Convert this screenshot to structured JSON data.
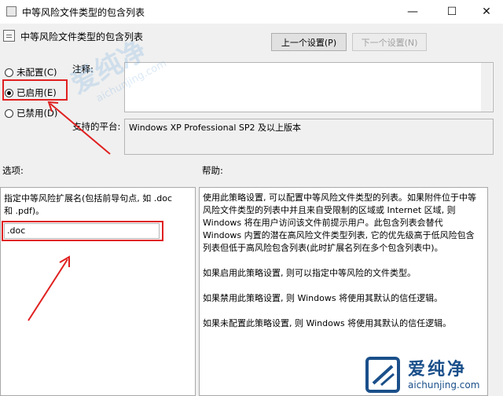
{
  "window": {
    "title": "中等风险文件类型的包含列表",
    "controls": {
      "minimize": "—",
      "maximize": "☐",
      "close": "✕"
    }
  },
  "header": {
    "title": "中等风险文件类型的包含列表",
    "prev_button": "上一个设置(P)",
    "next_button": "下一个设置(N)"
  },
  "state": {
    "options": [
      {
        "label": "未配置(C)",
        "checked": false
      },
      {
        "label": "已启用(E)",
        "checked": true
      },
      {
        "label": "已禁用(D)",
        "checked": false
      }
    ],
    "comment_label": "注释:",
    "comment_value": "",
    "supported_label": "支持的平台:",
    "supported_value": "Windows XP Professional SP2 及以上版本"
  },
  "options_pane": {
    "heading": "选项:",
    "description": "指定中等风险扩展名(包括前导句点, 如 .doc\n和 .pdf)。",
    "input_value": ".doc"
  },
  "help_pane": {
    "heading": "帮助:",
    "text": "使用此策略设置, 可以配置中等风险文件类型的列表。如果附件位于中等\n风险文件类型的列表中并且来自受限制的区域或 Internet 区域, 则\nWindows 将在用户访问该文件前提示用户。此包含列表会替代\nWindows 内置的潜在高风险文件类型列表, 它的优先级高于低风险包含\n列表但低于高风险包含列表(此时扩展名列在多个包含列表中)。\n\n如果启用此策略设置, 则可以指定中等风险的文件类型。\n\n如果禁用此策略设置, 则 Windows 将使用其默认的信任逻辑。\n\n如果未配置此策略设置, 则 Windows 将使用其默认的信任逻辑。"
  },
  "watermark": {
    "brand_cn": "爱纯净",
    "brand_url": "aichunjing.com"
  },
  "colors": {
    "highlight": "#e02020",
    "brand": "#1a4f8a"
  }
}
